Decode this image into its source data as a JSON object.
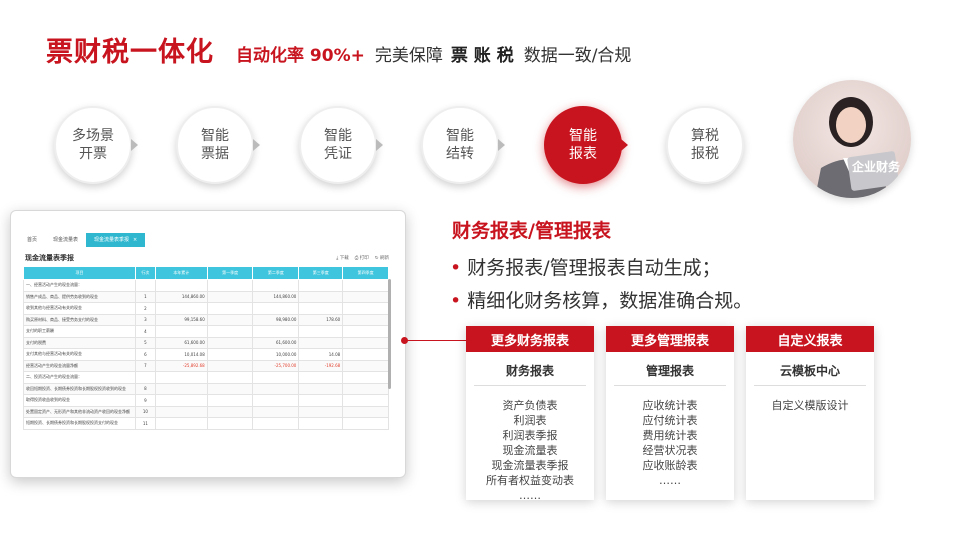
{
  "header": {
    "title": "票财税一体化",
    "automation": "自动化率 90%+",
    "desc1": "完美保障",
    "bold_items": "票 账 税",
    "desc2": "数据一致/合规"
  },
  "steps": [
    {
      "line1": "多场景",
      "line2": "开票"
    },
    {
      "line1": "智能",
      "line2": "票据"
    },
    {
      "line1": "智能",
      "line2": "凭证"
    },
    {
      "line1": "智能",
      "line2": "结转"
    },
    {
      "line1": "智能",
      "line2": "报表",
      "active": true
    },
    {
      "line1": "算税",
      "line2": "报税"
    }
  ],
  "persona": {
    "label": "企业财务"
  },
  "screen": {
    "tabs": [
      "首页",
      "现金流量表",
      "现金流量表季报"
    ],
    "report_title": "现金流量表季报",
    "toolbar": [
      "下载",
      "打印",
      "刷新"
    ],
    "columns": [
      "项目",
      "行次",
      "本年累计",
      "第一季度",
      "第二季度",
      "第三季度",
      "第四季度"
    ],
    "rows": [
      [
        "一、经营活动产生的现金流量：",
        "",
        "",
        "",
        "",
        "",
        ""
      ],
      [
        "销售产成品、商品、提供劳务收到的现金",
        "1",
        "144,860.00",
        "",
        "144,860.00",
        "",
        ""
      ],
      [
        "收到其他与经营活动有关的现金",
        "2",
        "",
        "",
        "",
        "",
        ""
      ],
      [
        "购买原材料、商品、接受劳务支付的现金",
        "3",
        "99,158.60",
        "",
        "98,980.00",
        "178.60",
        ""
      ],
      [
        "支付的职工薪酬",
        "4",
        "",
        "",
        "",
        "",
        ""
      ],
      [
        "支付的税费",
        "5",
        "61,600.00",
        "",
        "61,600.00",
        "",
        ""
      ],
      [
        "支付其他与经营活动有关的现金",
        "6",
        "10,014.08",
        "",
        "10,000.00",
        "14.08",
        ""
      ],
      [
        "经营活动产生的现金流量净额",
        "7",
        "-25,892.68",
        "",
        "-25,700.00",
        "-192.68",
        ""
      ],
      [
        "二、投资活动产生的现金流量：",
        "",
        "",
        "",
        "",
        "",
        ""
      ],
      [
        "收回短期投资、长期债券投资和长期股权投资收到的现金",
        "8",
        "",
        "",
        "",
        "",
        ""
      ],
      [
        "取得投资收益收到的现金",
        "9",
        "",
        "",
        "",
        "",
        ""
      ],
      [
        "处置固定资产、无形资产和其他非流动资产收回的现金净额",
        "10",
        "",
        "",
        "",
        "",
        ""
      ],
      [
        "短期投资、长期债券投资和长期股权投资支付的现金",
        "11",
        "",
        "",
        "",
        "",
        ""
      ]
    ],
    "negative_row": 7
  },
  "right": {
    "title": "财务报表/管理报表",
    "bullets": [
      "财务报表/管理报表自动生成；",
      "精细化财务核算，数据准确合规。"
    ]
  },
  "cards": [
    {
      "head": "更多财务报表",
      "sub": "财务报表",
      "items": [
        "资产负债表",
        "利润表",
        "利润表季报",
        "现金流量表",
        "现金流量表季报",
        "所有者权益变动表",
        "……"
      ]
    },
    {
      "head": "更多管理报表",
      "sub": "管理报表",
      "items": [
        "应收统计表",
        "应付统计表",
        "费用统计表",
        "经营状况表",
        "应收账龄表",
        "……"
      ]
    },
    {
      "head": "自定义报表",
      "sub": "云模板中心",
      "items": [
        "自定义模版设计"
      ]
    }
  ],
  "colors": {
    "brand_red": "#c8141e",
    "table_header": "#3fc5dd",
    "tab_active": "#2fb7cf",
    "negative": "#e2402e"
  }
}
